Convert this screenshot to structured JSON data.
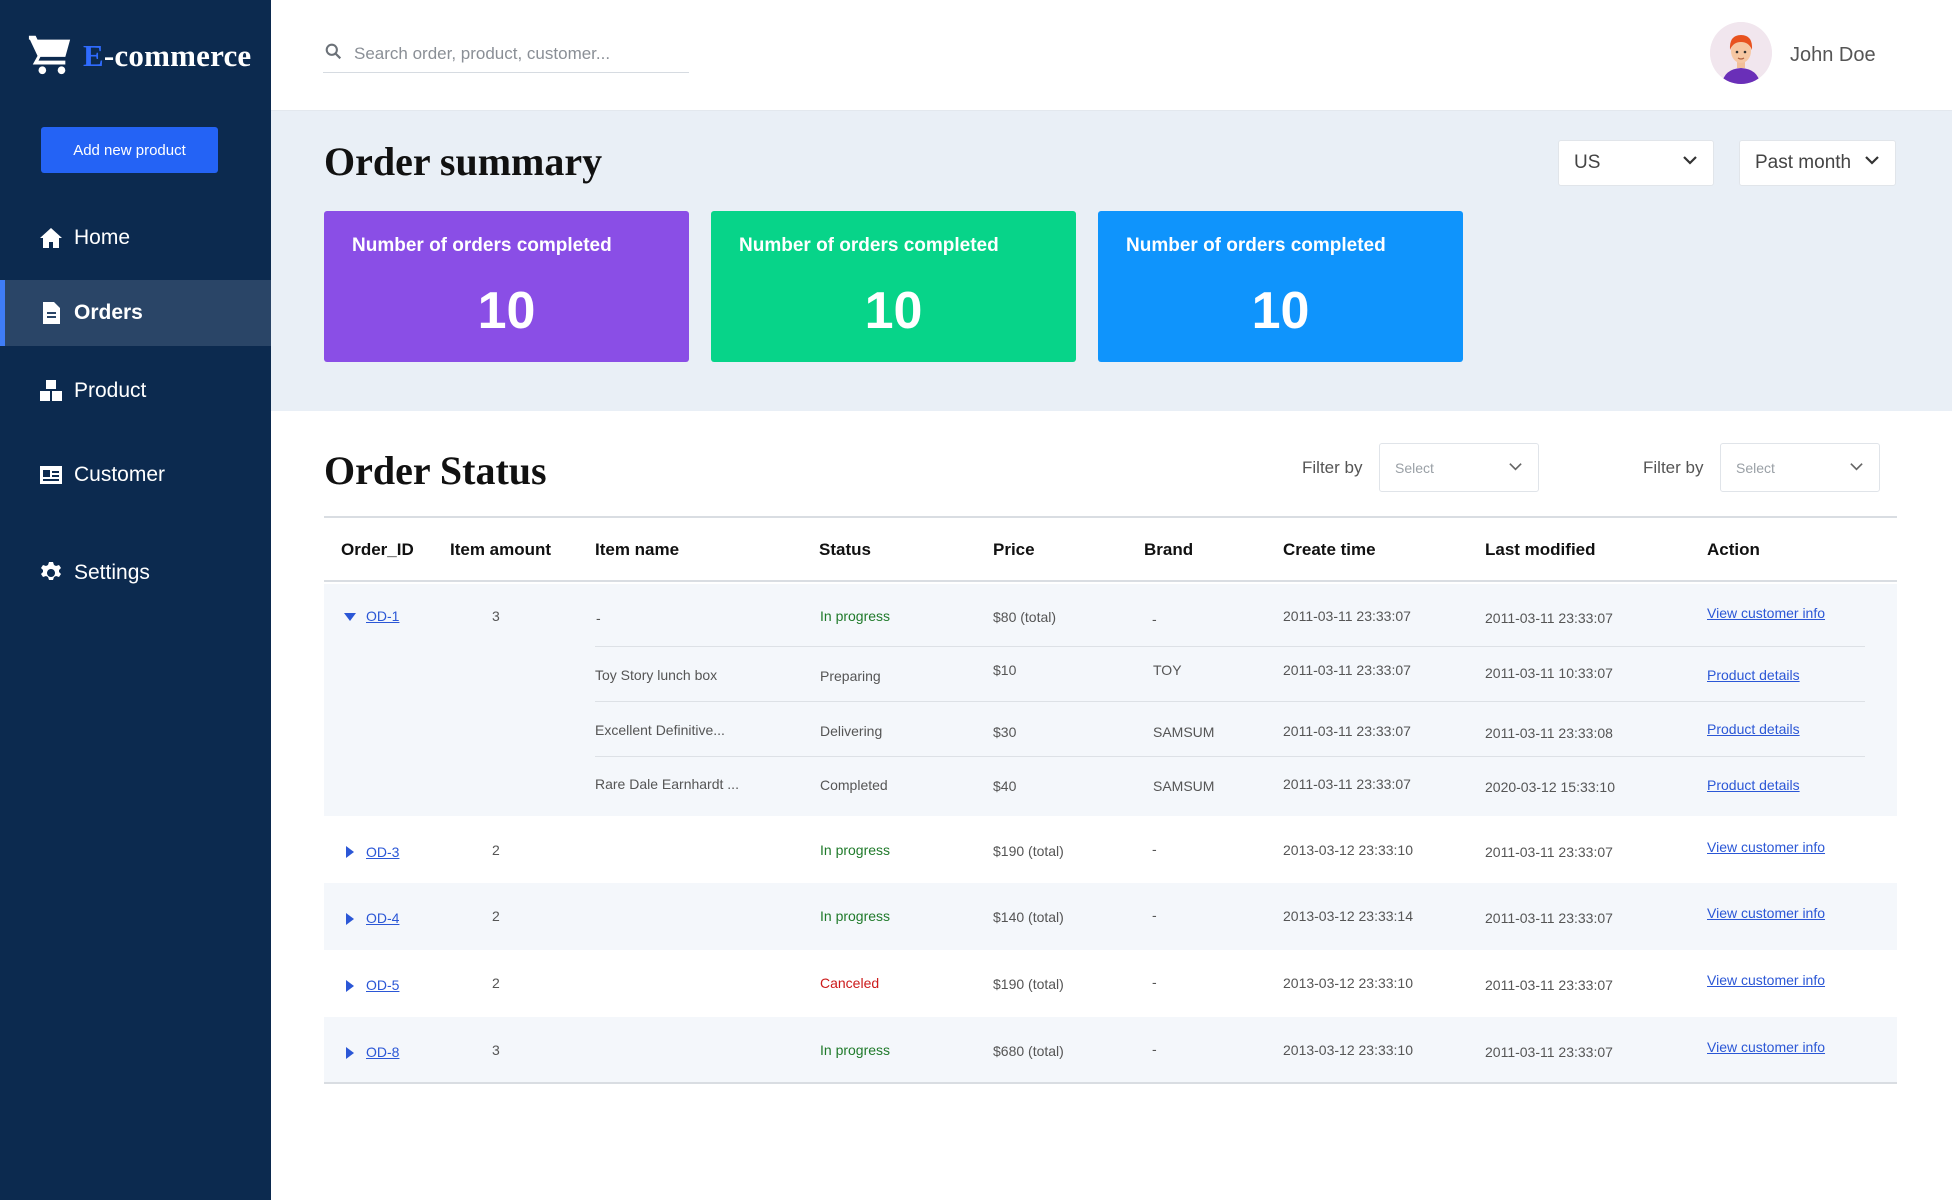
{
  "app": {
    "logo_first": "E",
    "logo_rest": "-commerce"
  },
  "sidebar": {
    "add_button": "Add new product",
    "items": [
      {
        "label": "Home",
        "icon": "home-icon"
      },
      {
        "label": "Orders",
        "icon": "document-icon",
        "active": true
      },
      {
        "label": "Product",
        "icon": "boxes-icon"
      },
      {
        "label": "Customer",
        "icon": "id-card-icon"
      },
      {
        "label": "Settings",
        "icon": "gear-icon"
      }
    ]
  },
  "header": {
    "search_placeholder": "Search order, product, customer...",
    "user_name": "John Doe"
  },
  "summary": {
    "title": "Order summary",
    "region": "US",
    "period": "Past month",
    "cards": [
      {
        "label": "Number of orders completed",
        "value": "10",
        "color": "#8a4ee6"
      },
      {
        "label": "Number of orders completed",
        "value": "10",
        "color": "#07d489"
      },
      {
        "label": "Number of orders completed",
        "value": "10",
        "color": "#0f94fc"
      }
    ]
  },
  "order_status": {
    "title": "Order Status",
    "filters": [
      {
        "label": "Filter by",
        "placeholder": "Select"
      },
      {
        "label": "Filter by",
        "placeholder": "Select"
      }
    ],
    "columns": [
      "Order_ID",
      "Item amount",
      "Item name",
      "Status",
      "Price",
      "Brand",
      "Create time",
      "Last modified",
      "Action"
    ],
    "expanded_order": {
      "id": "OD-1",
      "amount": "3",
      "name": "-",
      "status": "In progress",
      "price": "$80 (total)",
      "brand": "-",
      "created": "2011-03-11 23:33:07",
      "modified": "2011-03-11 23:33:07",
      "action": "View customer info",
      "items": [
        {
          "name": "Toy Story lunch box",
          "status": "Preparing",
          "price": "$10",
          "brand": "TOY",
          "created": "2011-03-11 23:33:07",
          "modified": "2011-03-11 10:33:07",
          "action": "Product details"
        },
        {
          "name": "Excellent Definitive...",
          "status": "Delivering",
          "price": "$30",
          "brand": "SAMSUM",
          "created": "2011-03-11 23:33:07",
          "modified": "2011-03-11 23:33:08",
          "action": "Product details"
        },
        {
          "name": "Rare Dale Earnhardt ...",
          "status": "Completed",
          "price": "$40",
          "brand": "SAMSUM",
          "created": "2011-03-11 23:33:07",
          "modified": "2020-03-12 15:33:10",
          "action": "Product details"
        }
      ]
    },
    "orders": [
      {
        "id": "OD-3",
        "amount": "2",
        "status": "In progress",
        "price": "$190 (total)",
        "brand": "-",
        "created": "2013-03-12 23:33:10",
        "modified": "2011-03-11 23:33:07",
        "action": "View customer info"
      },
      {
        "id": "OD-4",
        "amount": "2",
        "status": "In progress",
        "price": "$140 (total)",
        "brand": "-",
        "created": "2013-03-12 23:33:14",
        "modified": "2011-03-11 23:33:07",
        "action": "View customer info"
      },
      {
        "id": "OD-5",
        "amount": "2",
        "status": "Canceled",
        "price": "$190 (total)",
        "brand": "-",
        "created": "2013-03-12 23:33:10",
        "modified": "2011-03-11 23:33:07",
        "action": "View customer info"
      },
      {
        "id": "OD-8",
        "amount": "3",
        "status": "In progress",
        "price": "$680 (total)",
        "brand": "-",
        "created": "2013-03-12 23:33:10",
        "modified": "2011-03-11 23:33:07",
        "action": "View customer info"
      }
    ]
  },
  "colors": {
    "sidebar_bg": "#0c2a4f",
    "accent": "#2463f5",
    "status_in_progress": "#1f7a2a",
    "status_canceled": "#cc1a1a",
    "link": "#2b57d6"
  }
}
